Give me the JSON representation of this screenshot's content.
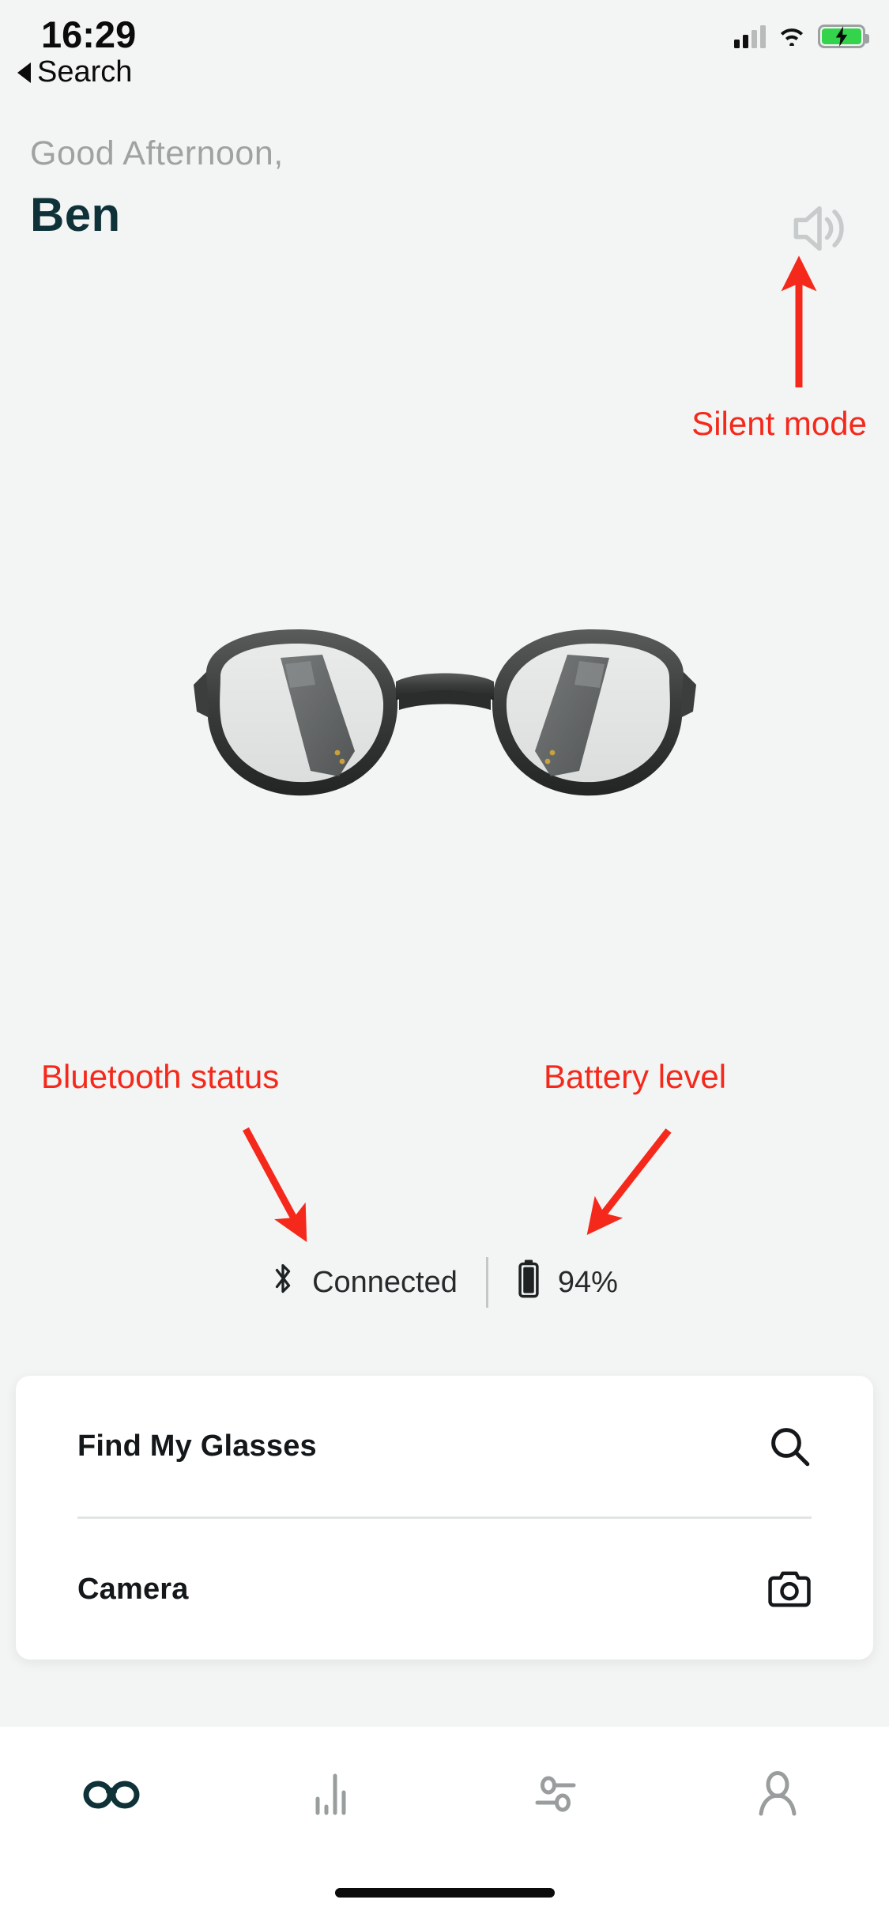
{
  "status_bar": {
    "time": "16:29",
    "back_label": "Search",
    "icons": {
      "signal": "cellular-signal-icon",
      "wifi": "wifi-icon",
      "battery": "battery-charging-icon"
    }
  },
  "header": {
    "greeting": "Good Afternoon,",
    "user_name": "Ben",
    "sound_button": "speaker-on-icon"
  },
  "hero": {
    "product": "smart-glasses-image"
  },
  "annotations": [
    {
      "id": "silent",
      "text": "Silent mode",
      "color": "#f5291b",
      "points_to": "speaker-on-icon"
    },
    {
      "id": "bluetooth",
      "text": "Bluetooth status",
      "color": "#f5291b",
      "points_to": "bluetooth-status"
    },
    {
      "id": "battery",
      "text": "Battery level",
      "color": "#f5291b",
      "points_to": "battery-level"
    }
  ],
  "device_status": {
    "bluetooth": {
      "icon": "bluetooth-icon",
      "label": "Connected"
    },
    "battery": {
      "icon": "battery-icon",
      "label": "94%"
    }
  },
  "actions": {
    "rows": [
      {
        "label": "Find My Glasses",
        "icon": "search-icon"
      },
      {
        "label": "Camera",
        "icon": "camera-icon"
      }
    ]
  },
  "tab_bar": {
    "active_color": "#0e3238",
    "inactive_color": "#9a9d9d",
    "tabs": [
      {
        "name": "glasses",
        "icon": "glasses-icon",
        "active": true
      },
      {
        "name": "stats",
        "icon": "bar-chart-icon",
        "active": false
      },
      {
        "name": "settings",
        "icon": "sliders-icon",
        "active": false
      },
      {
        "name": "profile",
        "icon": "person-icon",
        "active": false
      }
    ]
  },
  "colors": {
    "background": "#f3f4f4",
    "card": "#ffffff",
    "brand_dark": "#0e3238",
    "annotation_red": "#f5291b",
    "muted_text": "#a0a2a2"
  }
}
